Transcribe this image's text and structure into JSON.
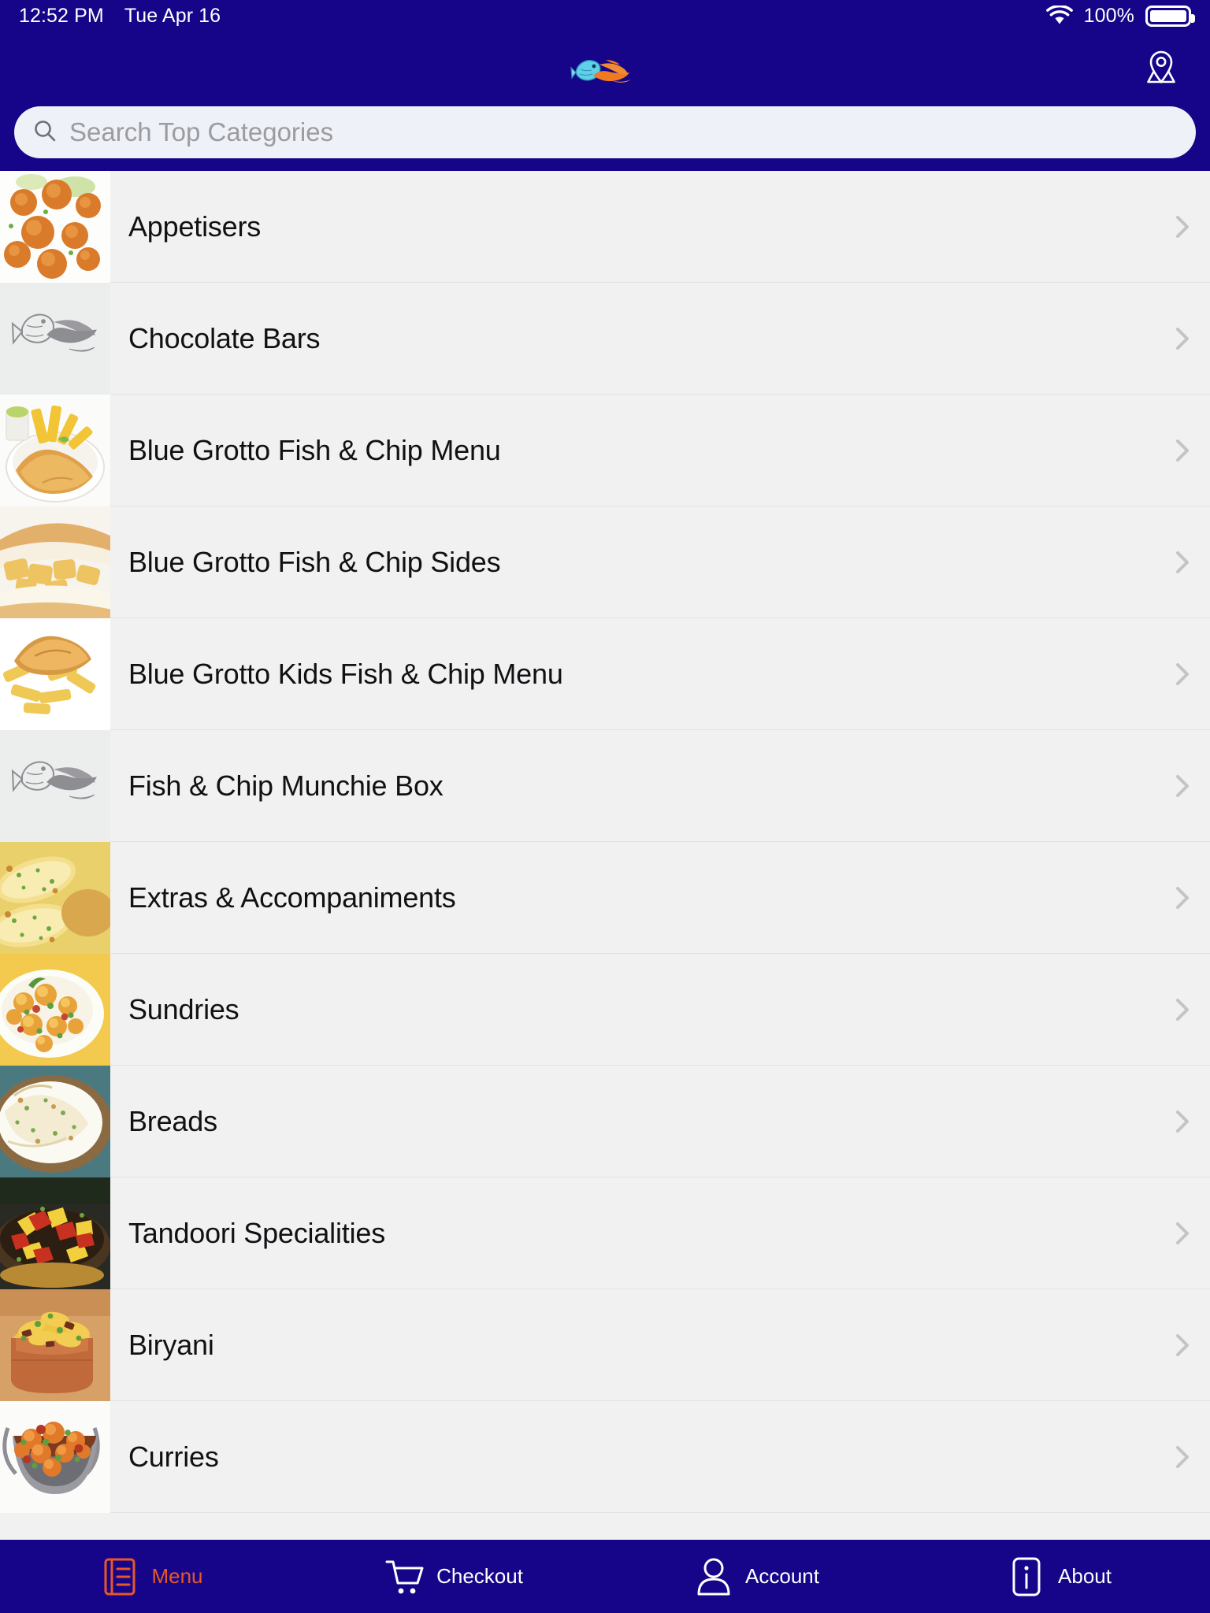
{
  "status_bar": {
    "time": "12:52 PM",
    "date": "Tue Apr 16",
    "wifi_icon": "wifi-icon",
    "battery_percent": "100%",
    "battery_icon": "battery-full-icon"
  },
  "header": {
    "logo_icon": "fish-and-chips-logo",
    "location_button_icon": "map-pin-icon",
    "brand_color": "#160589"
  },
  "search": {
    "placeholder": "Search Top Categories",
    "value": "",
    "icon": "search-icon"
  },
  "list": {
    "chevron_icon": "chevron-right-icon",
    "items": [
      {
        "label": "Appetisers",
        "thumb": "onion-bhaji-photo"
      },
      {
        "label": "Chocolate Bars",
        "thumb": "fish-placeholder-logo"
      },
      {
        "label": "Blue Grotto Fish & Chip Menu",
        "thumb": "fish-and-chips-bowl-photo"
      },
      {
        "label": "Blue Grotto Fish & Chip Sides",
        "thumb": "chip-butty-photo"
      },
      {
        "label": "Blue Grotto Kids Fish & Chip Menu",
        "thumb": "kids-fish-and-chips-photo"
      },
      {
        "label": "Fish & Chip Munchie Box",
        "thumb": "fish-placeholder-logo"
      },
      {
        "label": "Extras & Accompaniments",
        "thumb": "garlic-bread-photo"
      },
      {
        "label": "Sundries",
        "thumb": "bombay-potato-photo"
      },
      {
        "label": "Breads",
        "thumb": "naan-bread-photo"
      },
      {
        "label": "Tandoori Specialities",
        "thumb": "tandoori-platter-photo"
      },
      {
        "label": "Biryani",
        "thumb": "biryani-pot-photo"
      },
      {
        "label": "Curries",
        "thumb": "curry-balti-dish-photo"
      }
    ]
  },
  "tabbar": {
    "active_color": "#e8562a",
    "inactive_color": "#ffffff",
    "tabs": [
      {
        "label": "Menu",
        "icon": "menu-book-icon",
        "active": true
      },
      {
        "label": "Checkout",
        "icon": "shopping-cart-icon",
        "active": false
      },
      {
        "label": "Account",
        "icon": "person-icon",
        "active": false
      },
      {
        "label": "About",
        "icon": "info-icon",
        "active": false
      }
    ]
  }
}
